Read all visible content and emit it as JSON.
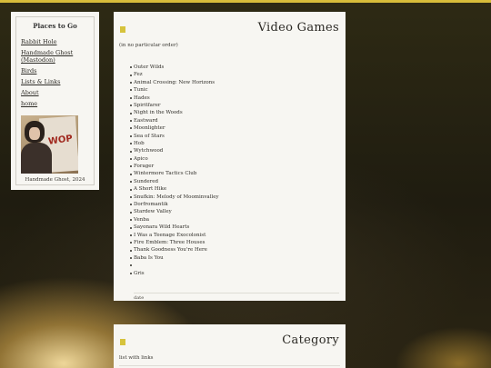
{
  "sidebar": {
    "title": "Places to Go",
    "links": [
      {
        "label": "Rabbit Hole"
      },
      {
        "label": "Handmade Ghost (Mastodon)"
      },
      {
        "label": "Birds"
      },
      {
        "label": "Lists & Links"
      },
      {
        "label": "About"
      },
      {
        "label": "home"
      }
    ],
    "photo_sign_text": "WOP",
    "caption": "Handmade Ghost, 2024"
  },
  "main": {
    "title": "Video Games",
    "subtitle": "(in no particular order)",
    "games": [
      "Outer Wilds",
      "Fez",
      "Animal Crossing: New Horizons",
      "Tunic",
      "Hades",
      "Spiritfarer",
      "Night in the Woods",
      "Eastward",
      "Moonlighter",
      "Sea of Stars",
      "Hob",
      "Wytchwood",
      "Apico",
      "Forager",
      "Wintermore Tactics Club",
      "Sundered",
      "A Short Hike",
      "Snufkin: Melody of Moominvalley",
      "Dorfromantik",
      "Stardew Valley",
      "Venba",
      "Sayonara Wild Hearts",
      "I Was a Teenage Exocolonist",
      "Fire Emblem: Three Houses",
      "Thank Goodness You're Here",
      "Baba Is You",
      "",
      "Gris"
    ],
    "date_label": "date"
  },
  "category": {
    "title": "Category",
    "subtitle": "list with links"
  },
  "colors": {
    "accent": "#d6c33c",
    "topbar": "#d8bd3a",
    "panel": "#f7f6f2"
  }
}
